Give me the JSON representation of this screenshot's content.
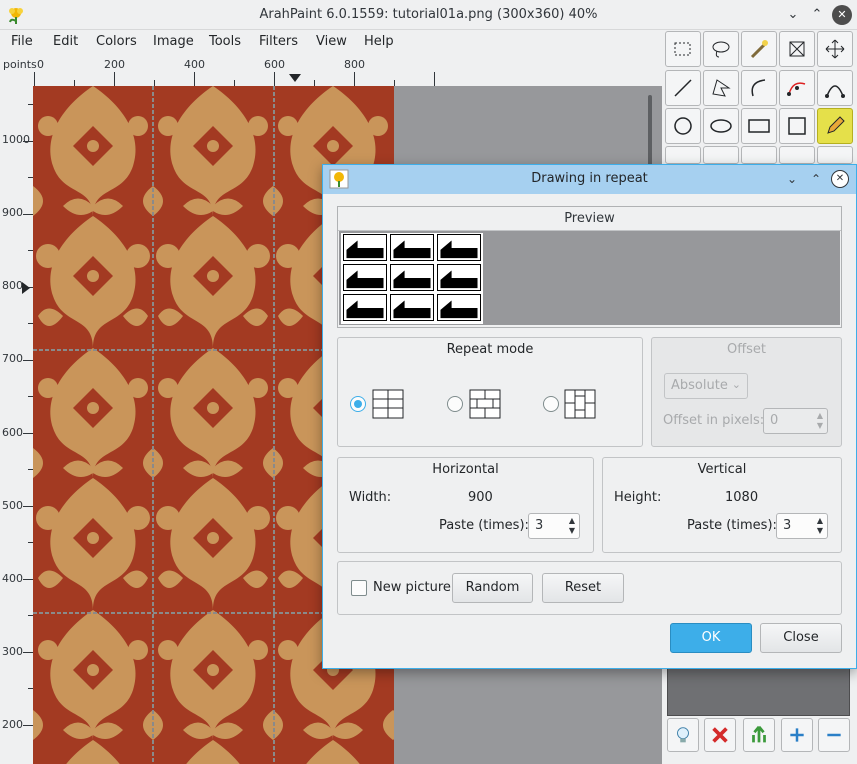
{
  "window": {
    "title": "ArahPaint 6.0.1559: tutorial01a.png (300x360) 40%",
    "controls": {
      "minimize": "⌄",
      "maximize": "⌃",
      "close": "✕"
    }
  },
  "menu": [
    "File",
    "Edit",
    "Colors",
    "Image",
    "Tools",
    "Filters",
    "View",
    "Help"
  ],
  "ruler": {
    "unit": "points",
    "h_labels": [
      "0",
      "200",
      "400",
      "600",
      "800"
    ],
    "v_labels": [
      "1000",
      "900",
      "800",
      "700",
      "600",
      "500",
      "400",
      "300",
      "200"
    ]
  },
  "toolbox": {
    "tools": [
      "rect-select-icon",
      "lasso-icon",
      "magic-wand-icon",
      "crop-icon",
      "move-icon",
      "line-icon",
      "polygon-icon",
      "curve-icon",
      "bezier-icon",
      "path-icon",
      "ellipse-filled-icon",
      "ellipse-icon",
      "rectangle-icon",
      "square-icon",
      "pencil-icon"
    ],
    "active_tool": "pencil-icon",
    "bottom_buttons": [
      "bulb-icon",
      "delete-icon",
      "merge-icon",
      "add-icon",
      "remove-icon"
    ]
  },
  "dialog": {
    "title": "Drawing in repeat",
    "controls": {
      "minimize": "⌄",
      "maximize": "⌃",
      "close": "✕"
    },
    "preview": {
      "label": "Preview"
    },
    "repeat_mode": {
      "label": "Repeat mode",
      "options": [
        "grid-icon",
        "brick-horizontal-icon",
        "brick-vertical-icon"
      ],
      "selected_index": 0
    },
    "offset": {
      "label": "Offset",
      "mode_value": "Absolute",
      "pixels_label": "Offset in pixels:",
      "pixels_value": "0",
      "enabled": false
    },
    "horizontal": {
      "label": "Horizontal",
      "width_label": "Width:",
      "width_value": "900",
      "paste_label": "Paste (times):",
      "paste_value": "3"
    },
    "vertical": {
      "label": "Vertical",
      "height_label": "Height:",
      "height_value": "1080",
      "paste_label": "Paste (times):",
      "paste_value": "3"
    },
    "new_picture_label": "New picture",
    "new_picture_checked": false,
    "random_label": "Random",
    "reset_label": "Reset",
    "ok_label": "OK",
    "close_label": "Close"
  },
  "colors": {
    "accent": "#3daee9",
    "pattern_red": "#a33a22",
    "pattern_tan": "#c9955a"
  }
}
